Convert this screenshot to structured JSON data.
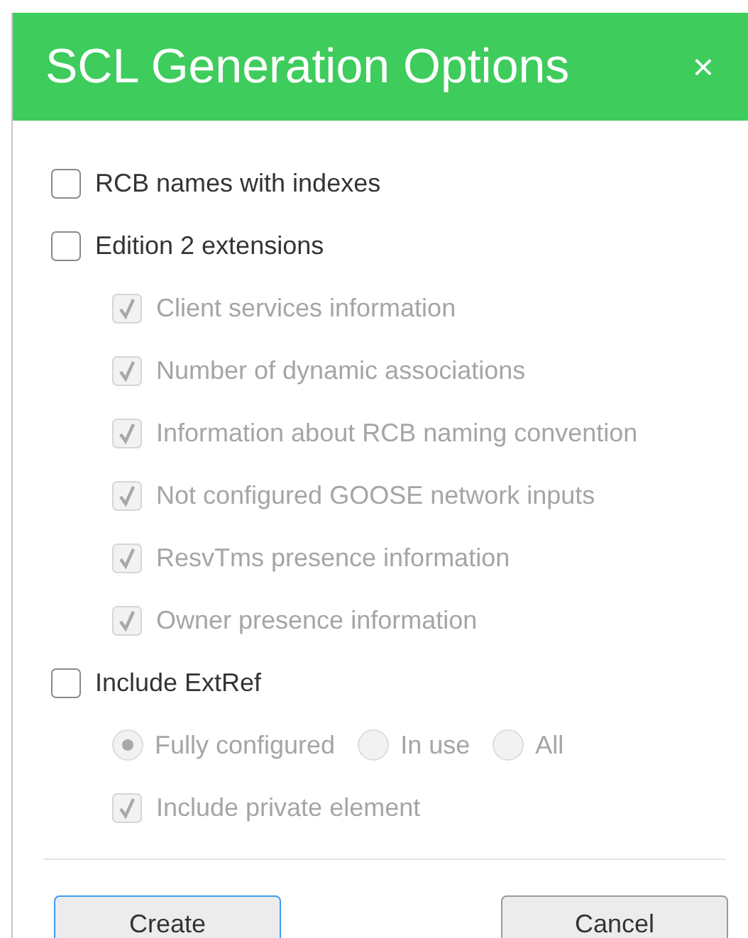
{
  "dialog": {
    "title": "SCL Generation Options",
    "close": "×"
  },
  "options": [
    {
      "kind": "checkbox",
      "label": "RCB names with indexes",
      "checked": false,
      "disabled": false
    },
    {
      "kind": "checkbox",
      "label": "Edition 2 extensions",
      "checked": false,
      "disabled": false,
      "children": [
        {
          "kind": "checkbox",
          "label": "Client services information",
          "checked": true,
          "disabled": true
        },
        {
          "kind": "checkbox",
          "label": "Number of dynamic associations",
          "checked": true,
          "disabled": true
        },
        {
          "kind": "checkbox",
          "label": "Information about RCB naming convention",
          "checked": true,
          "disabled": true
        },
        {
          "kind": "checkbox",
          "label": "Not configured GOOSE network inputs",
          "checked": true,
          "disabled": true
        },
        {
          "kind": "checkbox",
          "label": "ResvTms presence information",
          "checked": true,
          "disabled": true
        },
        {
          "kind": "checkbox",
          "label": "Owner presence information",
          "checked": true,
          "disabled": true
        }
      ]
    },
    {
      "kind": "checkbox",
      "label": "Include ExtRef",
      "checked": false,
      "disabled": false,
      "children": [
        {
          "kind": "radio-group",
          "disabled": true,
          "options": [
            {
              "label": "Fully configured",
              "selected": true
            },
            {
              "label": "In use",
              "selected": false
            },
            {
              "label": "All",
              "selected": false
            }
          ]
        },
        {
          "kind": "checkbox",
          "label": "Include private element",
          "checked": true,
          "disabled": true
        }
      ]
    }
  ],
  "buttons": [
    {
      "label": "Create",
      "focused": true
    },
    {
      "label": "Cancel",
      "focused": false
    }
  ]
}
